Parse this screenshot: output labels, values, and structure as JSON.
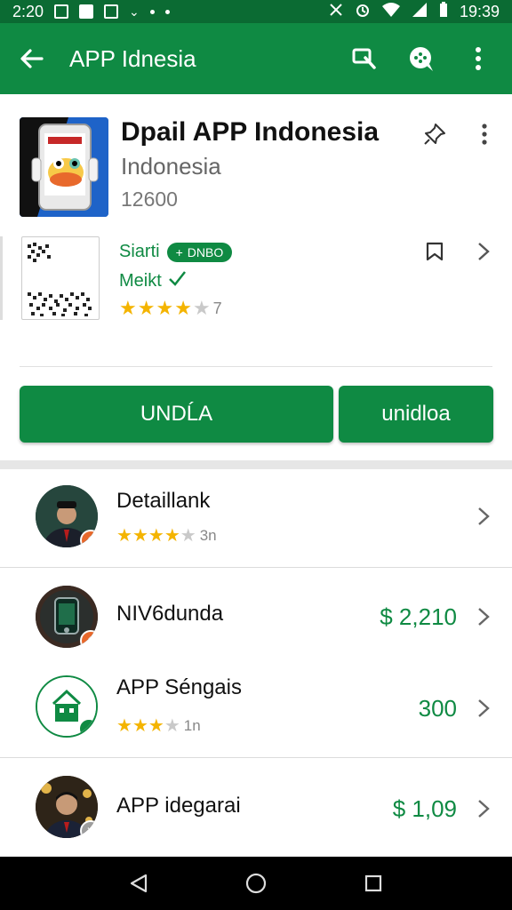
{
  "status_bar": {
    "time_left": "2:20",
    "time_right": "19:39"
  },
  "app_bar": {
    "title": "APP Idnesia"
  },
  "app": {
    "name": "Dpail APP Indonesia",
    "developer": "Indonesia",
    "count": "12600",
    "meta_label": "Siarti",
    "badge": "DNBO",
    "meta_label2": "Meikt",
    "rating_tail": "7"
  },
  "buttons": {
    "primary": "UNDĹA",
    "secondary": "unidloa"
  },
  "list": [
    {
      "title": "Detaillank",
      "rating_tail": "3n",
      "price": ""
    },
    {
      "title": "NIV6dunda",
      "rating_tail": "",
      "price": "$ 2,210"
    },
    {
      "title": "APP Séngais",
      "rating_tail": "1n",
      "price": "300"
    },
    {
      "title": "APP idegarai",
      "rating_tail": "",
      "price": "$ 1,09"
    }
  ],
  "colors": {
    "primary": "#0f8a43",
    "status_bar": "#0b6b33",
    "star": "#f4b400"
  }
}
